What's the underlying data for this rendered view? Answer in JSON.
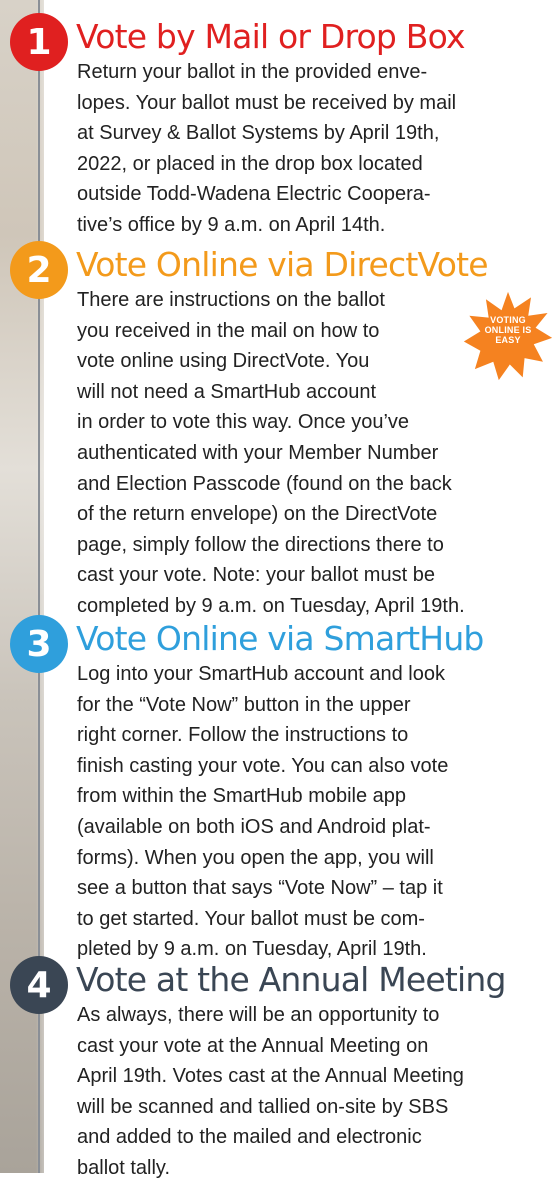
{
  "colors": {
    "step1": "#e02020",
    "step2": "#f39a1b",
    "step3": "#2f9fdc",
    "step4": "#3a4654",
    "burst": "#f58220"
  },
  "burst": {
    "line1": "VOTING",
    "line2": "ONLINE IS",
    "line3": "EASY"
  },
  "steps": [
    {
      "number": "1",
      "title": "Vote by Mail or Drop Box",
      "lines": [
        "Return your ballot in the provided enve-",
        "lopes. Your ballot must be received by mail",
        "at Survey & Ballot Systems by April 19th,",
        "2022, or placed in the drop box located",
        "outside Todd-Wadena Electric Coopera-",
        "tive’s office by 9 a.m. on April 14th."
      ]
    },
    {
      "number": "2",
      "title": "Vote Online via DirectVote",
      "lines": [
        "There are instructions on the ballot",
        "you received in the mail on how to",
        "vote online using DirectVote. You",
        "will not need a SmartHub account",
        "in order to vote this way. Once you’ve",
        "authenticated with your Member Number",
        "and Election Passcode (found on the back",
        "of the return envelope) on the DirectVote",
        "page, simply follow the directions there to",
        "cast your vote. Note: your ballot must be",
        "completed by 9 a.m. on Tuesday, April 19th."
      ]
    },
    {
      "number": "3",
      "title": "Vote Online via SmartHub",
      "lines": [
        "Log into your SmartHub account and look",
        "for the “Vote Now” button in the upper",
        "right corner. Follow the instructions to",
        "finish casting your vote. You can also vote",
        "from within the SmartHub mobile app",
        "(available on both iOS and Android plat-",
        "forms). When you open the app, you will",
        "see a button that says “Vote Now” – tap it",
        "to get started. Your ballot must be com-",
        "pleted by 9 a.m. on Tuesday, April 19th."
      ]
    },
    {
      "number": "4",
      "title": "Vote at the Annual Meeting",
      "lines": [
        "As always, there will be an opportunity to",
        "cast your vote at the Annual Meeting on",
        "April 19th. Votes cast at the Annual Meeting",
        "will be scanned and tallied on-site by SBS",
        "and added to the mailed and electronic",
        "ballot tally."
      ]
    }
  ]
}
